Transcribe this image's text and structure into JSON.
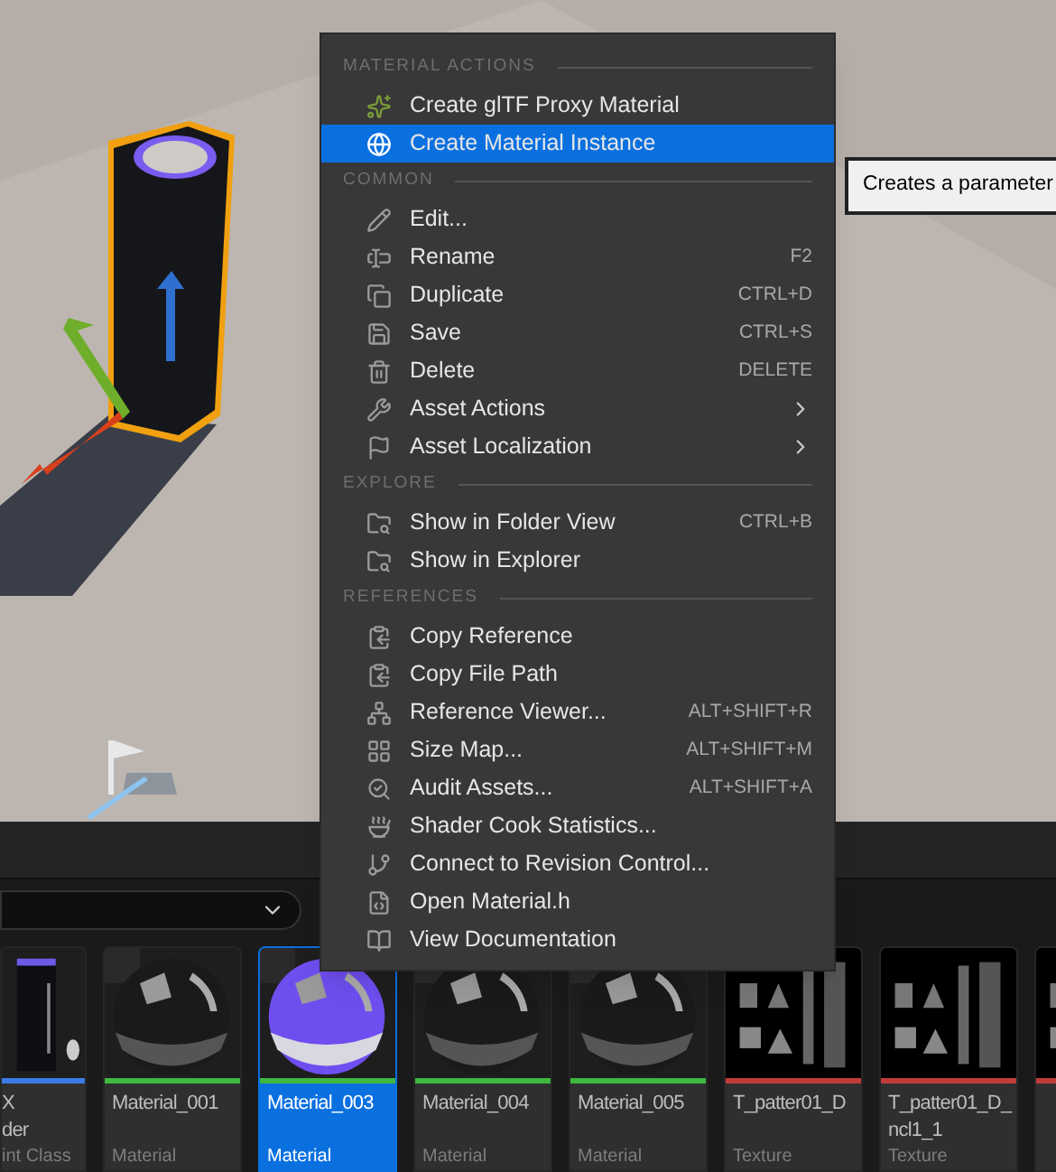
{
  "context_menu": {
    "sections": [
      {
        "header": "MATERIAL ACTIONS",
        "items": [
          {
            "label": "Create glTF Proxy Material",
            "selected": false
          },
          {
            "label": "Create Material Instance",
            "selected": true
          }
        ]
      },
      {
        "header": "COMMON",
        "items": [
          {
            "label": "Edit...",
            "selected": false
          },
          {
            "label": "Rename",
            "shortcut": "F2",
            "selected": false
          },
          {
            "label": "Duplicate",
            "shortcut": "CTRL+D",
            "selected": false
          },
          {
            "label": "Save",
            "shortcut": "CTRL+S",
            "selected": false
          },
          {
            "label": "Delete",
            "shortcut": "DELETE",
            "selected": false
          },
          {
            "label": "Asset Actions",
            "has_submenu": true,
            "selected": false
          },
          {
            "label": "Asset Localization",
            "has_submenu": true,
            "selected": false
          }
        ]
      },
      {
        "header": "EXPLORE",
        "items": [
          {
            "label": "Show in Folder View",
            "shortcut": "CTRL+B",
            "selected": false
          },
          {
            "label": "Show in Explorer",
            "selected": false
          }
        ]
      },
      {
        "header": "REFERENCES",
        "items": [
          {
            "label": "Copy Reference",
            "selected": false
          },
          {
            "label": "Copy File Path",
            "selected": false
          },
          {
            "label": "Reference Viewer...",
            "shortcut": "ALT+SHIFT+R",
            "selected": false
          },
          {
            "label": "Size Map...",
            "shortcut": "ALT+SHIFT+M",
            "selected": false
          },
          {
            "label": "Audit Assets...",
            "shortcut": "ALT+SHIFT+A",
            "selected": false
          },
          {
            "label": "Shader Cook Statistics...",
            "selected": false
          },
          {
            "label": "Connect to Revision Control...",
            "selected": false
          },
          {
            "label": "Open Material.h",
            "selected": false
          },
          {
            "label": "View Documentation",
            "selected": false
          }
        ]
      }
    ]
  },
  "tooltip": {
    "text": "Creates a parameter"
  },
  "assets": [
    {
      "kind": "blueprint",
      "name": "X\nder",
      "type": "int Class",
      "color": "#3a7be8",
      "selected": false
    },
    {
      "kind": "material",
      "name": "Material_001",
      "type": "Material",
      "color": "#3fb83f",
      "selected": false
    },
    {
      "kind": "material_blue",
      "name": "Material_003",
      "type": "Material",
      "color": "#3fb83f",
      "selected": true
    },
    {
      "kind": "material",
      "name": "Material_004",
      "type": "Material",
      "color": "#3fb83f",
      "selected": false
    },
    {
      "kind": "material",
      "name": "Material_005",
      "type": "Material",
      "color": "#3fb83f",
      "selected": false
    },
    {
      "kind": "texture",
      "name": "T_patter01_D",
      "type": "Texture",
      "color": "#c23b3b",
      "selected": false
    },
    {
      "kind": "texture",
      "name": "T_patter01_D_\nncl1_1",
      "type": "Texture",
      "color": "#c23b3b",
      "selected": false
    },
    {
      "kind": "texture",
      "color": "#c23b3b",
      "selected": false
    }
  ]
}
